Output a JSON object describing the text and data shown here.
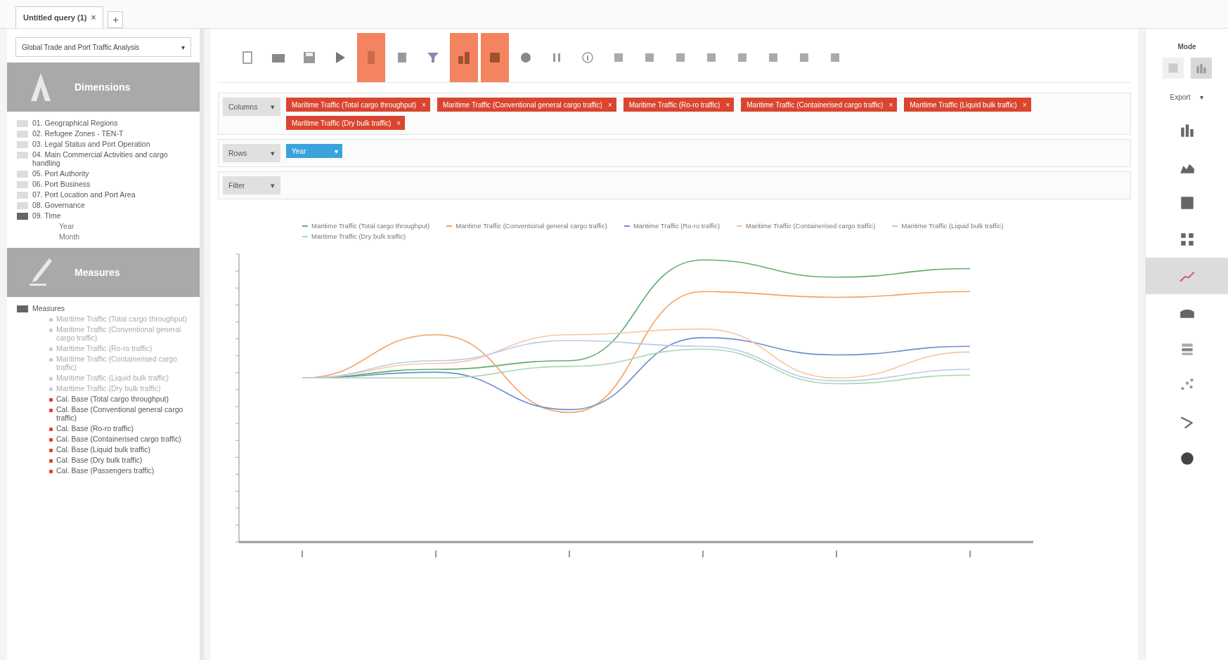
{
  "tabs": [
    {
      "label": "Untitled query (1)",
      "selected": true,
      "close": "×"
    }
  ],
  "new_tab": "+",
  "cube_select": {
    "value": "Global Trade and Port Traffic Analysis",
    "caret": "▾"
  },
  "dimensions": {
    "title": "Dimensions",
    "items": [
      {
        "label": "01. Geographical Regions",
        "expanded": false
      },
      {
        "label": "02. Refugee Zones - TEN-T",
        "expanded": false
      },
      {
        "label": "03. Legal Status and Port Operation",
        "expanded": false
      },
      {
        "label": "04. Main Commercial Activities and cargo handling",
        "expanded": false
      },
      {
        "label": "05. Port Authority",
        "expanded": false
      },
      {
        "label": "06. Port Business",
        "expanded": false
      },
      {
        "label": "07. Port Location and Port Area",
        "expanded": false
      },
      {
        "label": "08. Governance",
        "expanded": false
      },
      {
        "label": "09. Time",
        "expanded": true,
        "children": [
          {
            "label": "Year"
          },
          {
            "label": "Month"
          }
        ]
      }
    ]
  },
  "measures": {
    "title": "Measures",
    "folder": "Measures",
    "items": [
      {
        "label": "Maritime Traffic (Total cargo throughput)",
        "kind": "measure"
      },
      {
        "label": "Maritime Traffic (Conventional general cargo traffic)",
        "kind": "measure"
      },
      {
        "label": "Maritime Traffic (Ro-ro traffic)",
        "kind": "measure"
      },
      {
        "label": "Maritime Traffic (Containerised cargo traffic)",
        "kind": "measure"
      },
      {
        "label": "Maritime Traffic (Liquid bulk traffic)",
        "kind": "measure"
      },
      {
        "label": "Maritime Traffic (Dry bulk traffic)",
        "kind": "measure"
      },
      {
        "label": "Cal. Base (Total cargo throughput)",
        "kind": "calculated"
      },
      {
        "label": "Cal. Base (Conventional general cargo traffic)",
        "kind": "calculated"
      },
      {
        "label": "Cal. Base (Ro-ro traffic)",
        "kind": "calculated"
      },
      {
        "label": "Cal. Base (Containerised cargo traffic)",
        "kind": "calculated"
      },
      {
        "label": "Cal. Base (Liquid bulk traffic)",
        "kind": "calculated"
      },
      {
        "label": "Cal. Base (Dry bulk traffic)",
        "kind": "calculated"
      },
      {
        "label": "Cal. Base (Passengers traffic)",
        "kind": "calculated"
      }
    ]
  },
  "toolbar": [
    {
      "kind": "new",
      "selected": false
    },
    {
      "kind": "open",
      "selected": false
    },
    {
      "kind": "save",
      "selected": false
    },
    {
      "kind": "run",
      "selected": false
    },
    {
      "kind": "auto",
      "selected": true
    },
    {
      "kind": "fields",
      "selected": false
    },
    {
      "kind": "filter",
      "selected": false
    },
    {
      "kind": "chart-mode",
      "selected": true
    },
    {
      "kind": "table-mode",
      "selected": true
    },
    {
      "kind": "swap",
      "selected": false
    },
    {
      "kind": "pause",
      "selected": false
    },
    {
      "kind": "info",
      "selected": false
    },
    {
      "kind": "export",
      "selected": false
    },
    {
      "kind": "drill-up",
      "selected": false
    },
    {
      "kind": "drill-down",
      "selected": false
    },
    {
      "kind": "hide-parents",
      "selected": false
    },
    {
      "kind": "non-empty",
      "selected": false
    },
    {
      "kind": "page",
      "selected": false
    },
    {
      "kind": "edit",
      "selected": false
    },
    {
      "kind": "tag",
      "selected": false
    }
  ],
  "axes": [
    {
      "label": "Columns",
      "caret": "▾",
      "chips": [
        {
          "label": "Maritime Traffic (Total cargo throughput)",
          "kind": "measure",
          "remove": "×"
        },
        {
          "label": "Maritime Traffic (Conventional general cargo traffic)",
          "kind": "measure",
          "remove": "×"
        },
        {
          "label": "Maritime Traffic (Ro-ro traffic)",
          "kind": "measure",
          "remove": "×"
        },
        {
          "label": "Maritime Traffic (Containerised cargo traffic)",
          "kind": "measure",
          "remove": "×"
        },
        {
          "label": "Maritime Traffic (Liquid bulk traffic)",
          "kind": "measure",
          "remove": "×"
        },
        {
          "label": "Maritime Traffic (Dry bulk traffic)",
          "kind": "measure",
          "remove": "×"
        }
      ]
    },
    {
      "label": "Rows",
      "caret": "▾",
      "chips": [
        {
          "label": "Year",
          "kind": "level",
          "remove": "▾"
        }
      ]
    },
    {
      "label": "Filter",
      "caret": "▾"
    }
  ],
  "legend": [
    {
      "label": "Maritime Traffic (Total cargo throughput)",
      "color": "#5fae6e"
    },
    {
      "label": "Maritime Traffic (Conventional general cargo traffic)",
      "color": "#f4a15e"
    },
    {
      "label": "Maritime Traffic (Ro-ro traffic)",
      "color": "#6c8ed0"
    },
    {
      "label": "Maritime Traffic (Containerised cargo traffic)",
      "color": "#f7c7a0"
    },
    {
      "label": "Maritime Traffic (Liquid bulk traffic)",
      "color": "#a7d8b0"
    },
    {
      "label": "Maritime Traffic (Dry bulk traffic)",
      "color": "#b7cbe9"
    }
  ],
  "right_panel": {
    "mode_label": "Mode",
    "export_label": "Export",
    "export_caret": "▾",
    "modes": [
      {
        "kind": "table",
        "selected": false
      },
      {
        "kind": "chart",
        "selected": true
      }
    ],
    "chart_types": [
      {
        "kind": "bar",
        "selected": false
      },
      {
        "kind": "stacked",
        "selected": false
      },
      {
        "kind": "stacked100",
        "selected": false
      },
      {
        "kind": "multiple",
        "selected": false
      },
      {
        "kind": "line",
        "selected": true
      },
      {
        "kind": "area",
        "selected": false
      },
      {
        "kind": "heatgrid",
        "selected": false
      },
      {
        "kind": "scatter",
        "selected": false
      },
      {
        "kind": "treemap",
        "selected": false
      },
      {
        "kind": "pie",
        "selected": false
      }
    ]
  }
}
